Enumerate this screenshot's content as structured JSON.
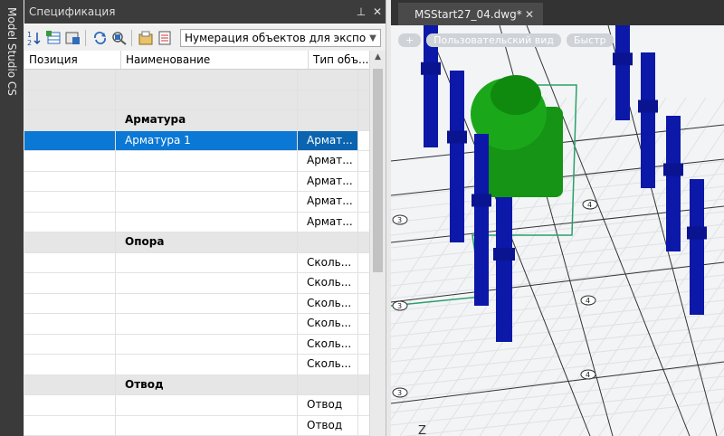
{
  "sidebar_tab": {
    "label": "Model Studio CS"
  },
  "panel": {
    "title": "Спецификация",
    "pin_label": "⊥",
    "close_label": "✕",
    "combo_value": "Нумерация объектов для экспор",
    "columns": [
      "Позиция",
      "Наименование",
      "Тип объ..."
    ],
    "rows": [
      {
        "type": "grey",
        "pos": "",
        "name": "",
        "kind": ""
      },
      {
        "type": "grey",
        "pos": "",
        "name": "",
        "kind": ""
      },
      {
        "type": "group",
        "pos": "",
        "name": "Арматура",
        "kind": ""
      },
      {
        "type": "sel",
        "pos": "",
        "name": "Арматура 1",
        "kind": "Армат..."
      },
      {
        "type": "row",
        "pos": "",
        "name": "",
        "kind": "Армат..."
      },
      {
        "type": "row",
        "pos": "",
        "name": "",
        "kind": "Армат..."
      },
      {
        "type": "row",
        "pos": "",
        "name": "",
        "kind": "Армат..."
      },
      {
        "type": "row",
        "pos": "",
        "name": "",
        "kind": "Армат..."
      },
      {
        "type": "group",
        "pos": "",
        "name": "Опора",
        "kind": ""
      },
      {
        "type": "row",
        "pos": "",
        "name": "",
        "kind": "Сколь..."
      },
      {
        "type": "row",
        "pos": "",
        "name": "",
        "kind": "Сколь..."
      },
      {
        "type": "row",
        "pos": "",
        "name": "",
        "kind": "Сколь..."
      },
      {
        "type": "row",
        "pos": "",
        "name": "",
        "kind": "Сколь..."
      },
      {
        "type": "row",
        "pos": "",
        "name": "",
        "kind": "Сколь..."
      },
      {
        "type": "row",
        "pos": "",
        "name": "",
        "kind": "Сколь..."
      },
      {
        "type": "group",
        "pos": "",
        "name": "Отвод",
        "kind": ""
      },
      {
        "type": "row",
        "pos": "",
        "name": "",
        "kind": "Отвод"
      },
      {
        "type": "row",
        "pos": "",
        "name": "",
        "kind": "Отвод"
      }
    ]
  },
  "viewport": {
    "tab_title": "MSStart27_04.dwg*",
    "tab_close": "✕",
    "pill_plus": "+",
    "pill_view": "Пользовательский вид",
    "pill_fast": "Быстр",
    "node_label": "4",
    "node_label_3": "3",
    "axis_z": "Z",
    "colors": {
      "column": "#0b18a8",
      "equipment": "#159415",
      "pipe": "#2aa06a"
    }
  }
}
